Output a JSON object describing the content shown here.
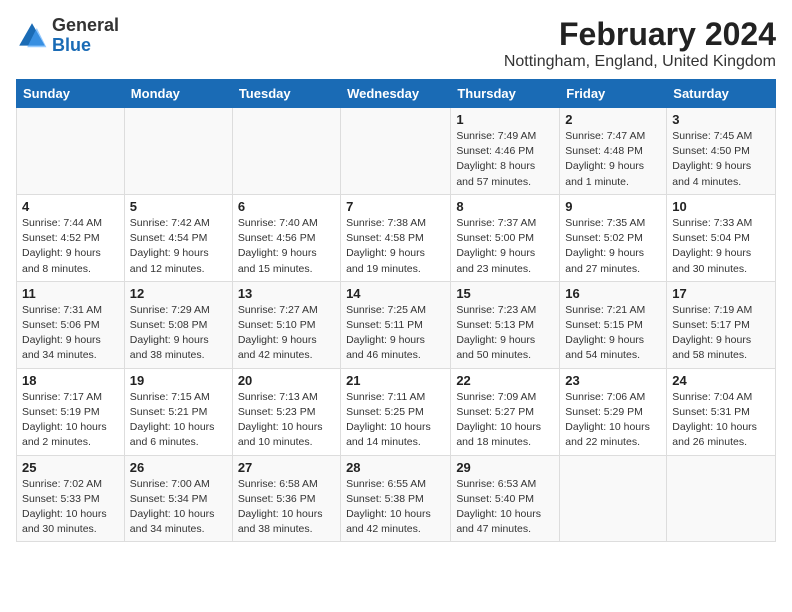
{
  "header": {
    "logo_general": "General",
    "logo_blue": "Blue",
    "month_year": "February 2024",
    "location": "Nottingham, England, United Kingdom"
  },
  "days_of_week": [
    "Sunday",
    "Monday",
    "Tuesday",
    "Wednesday",
    "Thursday",
    "Friday",
    "Saturday"
  ],
  "weeks": [
    [
      {
        "day": "",
        "info": ""
      },
      {
        "day": "",
        "info": ""
      },
      {
        "day": "",
        "info": ""
      },
      {
        "day": "",
        "info": ""
      },
      {
        "day": "1",
        "info": "Sunrise: 7:49 AM\nSunset: 4:46 PM\nDaylight: 8 hours\nand 57 minutes."
      },
      {
        "day": "2",
        "info": "Sunrise: 7:47 AM\nSunset: 4:48 PM\nDaylight: 9 hours\nand 1 minute."
      },
      {
        "day": "3",
        "info": "Sunrise: 7:45 AM\nSunset: 4:50 PM\nDaylight: 9 hours\nand 4 minutes."
      }
    ],
    [
      {
        "day": "4",
        "info": "Sunrise: 7:44 AM\nSunset: 4:52 PM\nDaylight: 9 hours\nand 8 minutes."
      },
      {
        "day": "5",
        "info": "Sunrise: 7:42 AM\nSunset: 4:54 PM\nDaylight: 9 hours\nand 12 minutes."
      },
      {
        "day": "6",
        "info": "Sunrise: 7:40 AM\nSunset: 4:56 PM\nDaylight: 9 hours\nand 15 minutes."
      },
      {
        "day": "7",
        "info": "Sunrise: 7:38 AM\nSunset: 4:58 PM\nDaylight: 9 hours\nand 19 minutes."
      },
      {
        "day": "8",
        "info": "Sunrise: 7:37 AM\nSunset: 5:00 PM\nDaylight: 9 hours\nand 23 minutes."
      },
      {
        "day": "9",
        "info": "Sunrise: 7:35 AM\nSunset: 5:02 PM\nDaylight: 9 hours\nand 27 minutes."
      },
      {
        "day": "10",
        "info": "Sunrise: 7:33 AM\nSunset: 5:04 PM\nDaylight: 9 hours\nand 30 minutes."
      }
    ],
    [
      {
        "day": "11",
        "info": "Sunrise: 7:31 AM\nSunset: 5:06 PM\nDaylight: 9 hours\nand 34 minutes."
      },
      {
        "day": "12",
        "info": "Sunrise: 7:29 AM\nSunset: 5:08 PM\nDaylight: 9 hours\nand 38 minutes."
      },
      {
        "day": "13",
        "info": "Sunrise: 7:27 AM\nSunset: 5:10 PM\nDaylight: 9 hours\nand 42 minutes."
      },
      {
        "day": "14",
        "info": "Sunrise: 7:25 AM\nSunset: 5:11 PM\nDaylight: 9 hours\nand 46 minutes."
      },
      {
        "day": "15",
        "info": "Sunrise: 7:23 AM\nSunset: 5:13 PM\nDaylight: 9 hours\nand 50 minutes."
      },
      {
        "day": "16",
        "info": "Sunrise: 7:21 AM\nSunset: 5:15 PM\nDaylight: 9 hours\nand 54 minutes."
      },
      {
        "day": "17",
        "info": "Sunrise: 7:19 AM\nSunset: 5:17 PM\nDaylight: 9 hours\nand 58 minutes."
      }
    ],
    [
      {
        "day": "18",
        "info": "Sunrise: 7:17 AM\nSunset: 5:19 PM\nDaylight: 10 hours\nand 2 minutes."
      },
      {
        "day": "19",
        "info": "Sunrise: 7:15 AM\nSunset: 5:21 PM\nDaylight: 10 hours\nand 6 minutes."
      },
      {
        "day": "20",
        "info": "Sunrise: 7:13 AM\nSunset: 5:23 PM\nDaylight: 10 hours\nand 10 minutes."
      },
      {
        "day": "21",
        "info": "Sunrise: 7:11 AM\nSunset: 5:25 PM\nDaylight: 10 hours\nand 14 minutes."
      },
      {
        "day": "22",
        "info": "Sunrise: 7:09 AM\nSunset: 5:27 PM\nDaylight: 10 hours\nand 18 minutes."
      },
      {
        "day": "23",
        "info": "Sunrise: 7:06 AM\nSunset: 5:29 PM\nDaylight: 10 hours\nand 22 minutes."
      },
      {
        "day": "24",
        "info": "Sunrise: 7:04 AM\nSunset: 5:31 PM\nDaylight: 10 hours\nand 26 minutes."
      }
    ],
    [
      {
        "day": "25",
        "info": "Sunrise: 7:02 AM\nSunset: 5:33 PM\nDaylight: 10 hours\nand 30 minutes."
      },
      {
        "day": "26",
        "info": "Sunrise: 7:00 AM\nSunset: 5:34 PM\nDaylight: 10 hours\nand 34 minutes."
      },
      {
        "day": "27",
        "info": "Sunrise: 6:58 AM\nSunset: 5:36 PM\nDaylight: 10 hours\nand 38 minutes."
      },
      {
        "day": "28",
        "info": "Sunrise: 6:55 AM\nSunset: 5:38 PM\nDaylight: 10 hours\nand 42 minutes."
      },
      {
        "day": "29",
        "info": "Sunrise: 6:53 AM\nSunset: 5:40 PM\nDaylight: 10 hours\nand 47 minutes."
      },
      {
        "day": "",
        "info": ""
      },
      {
        "day": "",
        "info": ""
      }
    ]
  ]
}
